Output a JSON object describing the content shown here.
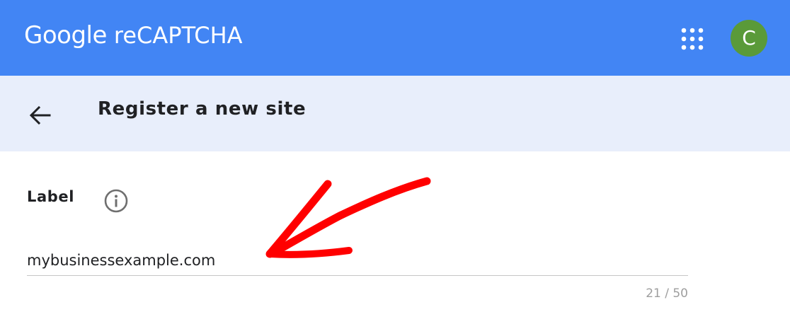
{
  "header": {
    "brand_google": "Google",
    "brand_product": "reCAPTCHA",
    "apps_icon": "apps-grid-icon",
    "avatar_initial": "C",
    "avatar_color": "#5a9a39",
    "bar_color": "#4285f4"
  },
  "subheader": {
    "back_icon": "arrow-back-icon",
    "title": "Register a new site",
    "bg_color": "#e8eefb"
  },
  "form": {
    "label": {
      "text": "Label",
      "info_icon": "info-icon"
    },
    "input": {
      "value": "mybusinessexample.com"
    },
    "counter": "21 / 50"
  },
  "annotation": {
    "icon": "red-arrow-annotation",
    "color": "#ff0000"
  }
}
